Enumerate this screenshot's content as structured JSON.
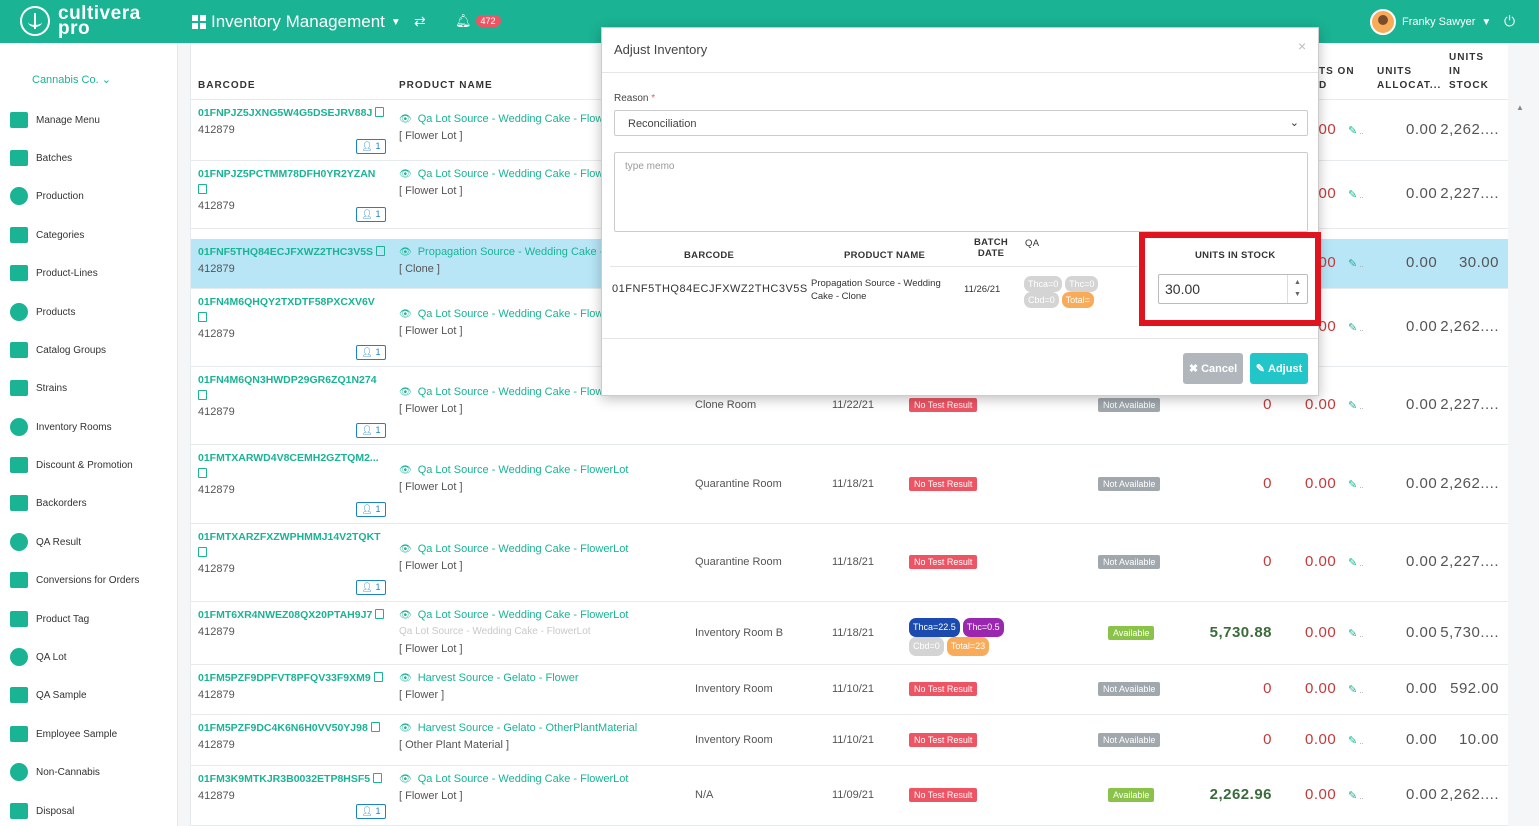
{
  "brand": {
    "line1": "cultivera",
    "line2": "pro"
  },
  "header": {
    "title": "Inventory Management",
    "notifications": "472",
    "user_name": "Franky Sawyer"
  },
  "sidebar": {
    "company": "Cannabis Co.",
    "items": [
      {
        "label": "Manage Menu",
        "icon": "menu-tag-icon"
      },
      {
        "label": "Batches",
        "icon": "batches-icon"
      },
      {
        "label": "Production",
        "icon": "production-icon"
      },
      {
        "label": "Categories",
        "icon": "categories-icon"
      },
      {
        "label": "Product-Lines",
        "icon": "product-lines-icon"
      },
      {
        "label": "Products",
        "icon": "products-icon"
      },
      {
        "label": "Catalog Groups",
        "icon": "catalog-icon"
      },
      {
        "label": "Strains",
        "icon": "strains-icon"
      },
      {
        "label": "Inventory Rooms",
        "icon": "rooms-icon"
      },
      {
        "label": "Discount & Promotion",
        "icon": "discount-icon"
      },
      {
        "label": "Backorders",
        "icon": "backorders-icon"
      },
      {
        "label": "QA Result",
        "icon": "flask-icon"
      },
      {
        "label": "Conversions for Orders",
        "icon": "recycle-icon"
      },
      {
        "label": "Product Tag",
        "icon": "tag-icon"
      },
      {
        "label": "QA Lot",
        "icon": "qa-lot-icon"
      },
      {
        "label": "QA Sample",
        "icon": "flask-icon"
      },
      {
        "label": "Employee Sample",
        "icon": "employee-icon"
      },
      {
        "label": "Non-Cannabis",
        "icon": "non-cannabis-icon"
      },
      {
        "label": "Disposal",
        "icon": "disposal-icon"
      }
    ]
  },
  "table": {
    "headers": {
      "barcode": "BARCODE",
      "product_name": "PRODUCT NAME",
      "on_hold": "TS ON\nD",
      "allocated": "UNITS\nALLOCAT...",
      "in_stock": "UNITS\nIN\nSTOCK"
    },
    "rows": [
      {
        "barcode": "01FNPJZ5JXNG5W4G5DSEJRV88J",
        "code": "412879",
        "chip": "1",
        "product": "Qa Lot Source - Wedding Cake - Flowe",
        "type": "[ Flower Lot ]",
        "on_hold": "0.00",
        "allocated": "0.00",
        "stock": "2,262...."
      },
      {
        "barcode": "01FNPJZ5PCTMM78DFH0YR2YZAN",
        "code": "412879",
        "chip": "1",
        "product": "Qa Lot Source - Wedding Cake - Flowe",
        "type": "[ Flower Lot ]",
        "on_hold": "0.00",
        "allocated": "0.00",
        "stock": "2,227...."
      },
      {
        "barcode": "01FNF5THQ84ECJFXWZ2THC3V5S",
        "code": "412879",
        "product": "Propagation Source - Wedding Cake -",
        "type": "[ Clone ]",
        "on_hold": "0.00",
        "allocated": "0.00",
        "stock": "30.00"
      },
      {
        "barcode": "01FN4M6QHQY2TXDTF58PXCXV6V",
        "code": "412879",
        "chip": "1",
        "product": "Qa Lot Source - Wedding Cake - Flowe",
        "type": "[ Flower Lot ]",
        "on_hold": "0.00",
        "allocated": "0.00",
        "stock": "2,262...."
      },
      {
        "barcode": "01FN4M6QN3HWDP29GR6ZQ1N274",
        "code": "412879",
        "chip": "1",
        "product": "Qa Lot Source - Wedding Cake - FlowerLot",
        "type": "[ Flower Lot ]",
        "room": "Clone Room",
        "date": "11/22/21",
        "qa": "No Test Result",
        "avail": "Not Available",
        "hold": "0",
        "on_hold": "0.00",
        "allocated": "0.00",
        "stock": "2,227...."
      },
      {
        "barcode": "01FMTXARWD4V8CEMH2GZTQM2...",
        "code": "412879",
        "chip": "1",
        "product": "Qa Lot Source - Wedding Cake - FlowerLot",
        "type": "[ Flower Lot ]",
        "room": "Quarantine Room",
        "date": "11/18/21",
        "qa": "No Test Result",
        "avail": "Not Available",
        "hold": "0",
        "on_hold": "0.00",
        "allocated": "0.00",
        "stock": "2,262...."
      },
      {
        "barcode": "01FMTXARZFXZWPHMMJ14V2TQKT",
        "code": "412879",
        "chip": "1",
        "product": "Qa Lot Source - Wedding Cake - FlowerLot",
        "type": "[ Flower Lot ]",
        "room": "Quarantine Room",
        "date": "11/18/21",
        "qa": "No Test Result",
        "avail": "Not Available",
        "hold": "0",
        "on_hold": "0.00",
        "allocated": "0.00",
        "stock": "2,227...."
      },
      {
        "barcode": "01FMT6XR4NWEZ08QX20PTAH9J7",
        "code": "412879",
        "product": "Qa Lot Source - Wedding Cake - FlowerLot",
        "product2": "Qa Lot Source - Wedding Cake - FlowerLot",
        "type": "[ Flower Lot ]",
        "room": "Inventory Room B",
        "date": "11/18/21",
        "pills": [
          "Thca=22.5",
          "Thc=0.5",
          "Cbd=0",
          "Total=23"
        ],
        "avail": "Available",
        "hold": "5,730.88",
        "on_hold": "0.00",
        "allocated": "0.00",
        "stock": "5,730...."
      },
      {
        "barcode": "01FM5PZF9DPFVT8PFQV33F9XM9",
        "code": "412879",
        "product": "Harvest Source - Gelato - Flower",
        "type": "[ Flower ]",
        "room": "Inventory Room",
        "date": "11/10/21",
        "qa": "No Test Result",
        "avail": "Not Available",
        "hold": "0",
        "on_hold": "0.00",
        "allocated": "0.00",
        "stock": "592.00"
      },
      {
        "barcode": "01FM5PZF9DC4K6N6H0VV50YJ98",
        "code": "412879",
        "product": "Harvest Source - Gelato - OtherPlantMaterial",
        "type": "[ Other Plant Material ]",
        "room": "Inventory Room",
        "date": "11/10/21",
        "qa": "No Test Result",
        "avail": "Not Available",
        "hold": "0",
        "on_hold": "0.00",
        "allocated": "0.00",
        "stock": "10.00"
      },
      {
        "barcode": "01FM3K9MTKJR3B0032ETP8HSF5",
        "code": "412879",
        "chip": "1",
        "product": "Qa Lot Source - Wedding Cake - FlowerLot",
        "type": "[ Flower Lot ]",
        "room": "N/A",
        "date": "11/09/21",
        "qa": "No Test Result",
        "avail": "Available",
        "hold": "2,262.96",
        "on_hold": "0.00",
        "allocated": "0.00",
        "stock": "2,262...."
      }
    ]
  },
  "modal": {
    "title": "Adjust Inventory",
    "close": "×",
    "reason_label": "Reason",
    "reason_value": "Reconciliation",
    "memo_placeholder": "type memo",
    "headers": {
      "barcode": "BARCODE",
      "product_name": "PRODUCT NAME",
      "batch_date_1": "BATCH",
      "batch_date_2": "DATE",
      "qa": "QA",
      "units": "UNITS IN STOCK"
    },
    "item": {
      "barcode": "01FNF5THQ84ECJFXWZ2THC3V5S",
      "product_1": "Propagation Source - Wedding",
      "product_2": "Cake - Clone",
      "date": "11/26/21",
      "pills": [
        "Thca=0",
        "Thc=0",
        "Cbd=0",
        "Total="
      ],
      "units": "30.00"
    },
    "cancel": "Cancel",
    "adjust": "Adjust"
  },
  "colors": {
    "brand": "#1ab394",
    "highlight_row": "#b8e6f7",
    "annotation_box": "#e0141e"
  }
}
